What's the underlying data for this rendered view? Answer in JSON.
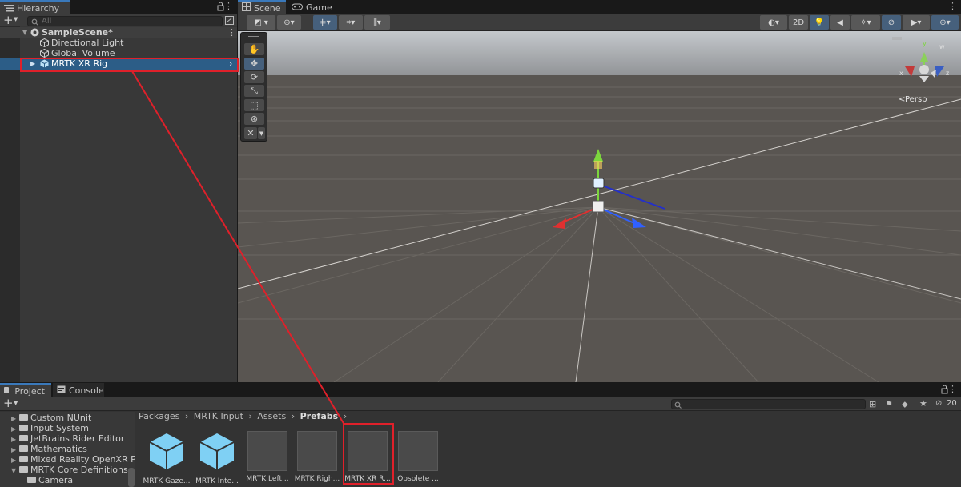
{
  "hierarchy": {
    "tab_label": "Hierarchy",
    "add_label": "+",
    "search_placeholder": "All",
    "scene_name": "SampleScene*",
    "items": [
      {
        "label": "Directional Light"
      },
      {
        "label": "Global Volume"
      },
      {
        "label": "MRTK XR Rig",
        "selected": true
      }
    ]
  },
  "scene": {
    "tabs": [
      {
        "label": "Scene",
        "active": true
      },
      {
        "label": "Game",
        "active": false
      }
    ],
    "toolbar": {
      "mode_2d": "2D"
    },
    "gizmo": {
      "persp_label": "Persp",
      "axis_x": "x",
      "axis_y": "y",
      "axis_z": "z"
    }
  },
  "project": {
    "tabs": [
      {
        "label": "Project",
        "active": true
      },
      {
        "label": "Console",
        "active": false
      }
    ],
    "add_label": "+",
    "badge_count": "20",
    "tree": [
      {
        "label": "Custom NUnit",
        "arrow": "▶"
      },
      {
        "label": "Input System",
        "arrow": "▶"
      },
      {
        "label": "JetBrains Rider Editor",
        "arrow": "▶"
      },
      {
        "label": "Mathematics",
        "arrow": "▶"
      },
      {
        "label": "Mixed Reality OpenXR Plu",
        "arrow": "▶"
      },
      {
        "label": "MRTK Core Definitions",
        "arrow": "▼"
      },
      {
        "label": "Camera",
        "arrow": ""
      }
    ],
    "breadcrumb": [
      "Packages",
      "MRTK Input",
      "Assets",
      "Prefabs"
    ],
    "assets": [
      {
        "label": "MRTK Gaze...",
        "kind": "cube"
      },
      {
        "label": "MRTK Inte...",
        "kind": "cube"
      },
      {
        "label": "MRTK Left...",
        "kind": "blank"
      },
      {
        "label": "MRTK Righ...",
        "kind": "blank"
      },
      {
        "label": "MRTK XR R...",
        "kind": "blank"
      },
      {
        "label": "Obsolete ...",
        "kind": "blank"
      }
    ]
  },
  "colors": {
    "selection": "#2c5d87",
    "annotation_red": "#e0202a",
    "prefab_cube": "#7fd0f4"
  }
}
